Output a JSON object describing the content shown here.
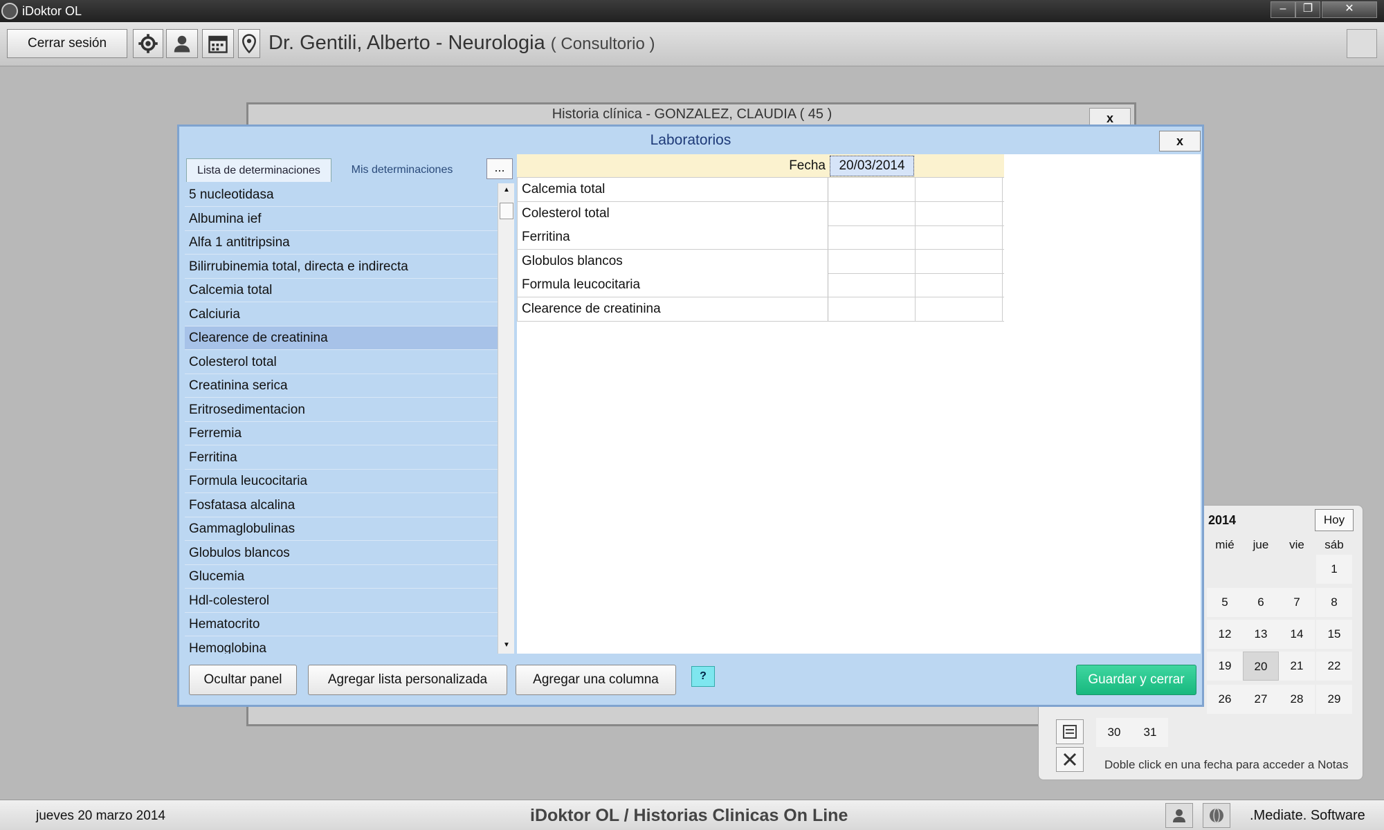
{
  "window": {
    "title": "iDoktor OL",
    "min": "–",
    "max": "❐",
    "close": "✕"
  },
  "toolbar": {
    "logout_label": "Cerrar sesión",
    "doctor": "Dr. Gentili, Alberto - Neurologia",
    "location": "( Consultorio )"
  },
  "history_window": {
    "title": "Historia clínica - GONZALEZ, CLAUDIA ( 45 )",
    "close": "x"
  },
  "dialog": {
    "title": "Laboratorios",
    "close": "x",
    "tabs": [
      "Lista de determinaciones",
      "Mis determinaciones"
    ],
    "more": "...",
    "list": [
      "5 nucleotidasa",
      "Albumina ief",
      "Alfa 1 antitripsina",
      "Bilirrubinemia total, directa e indirecta",
      "Calcemia total",
      "Calciuria",
      "Clearence de creatinina",
      "Colesterol total",
      "Creatinina serica",
      "Eritrosedimentacion",
      "Ferremia",
      "Ferritina",
      "Formula leucocitaria",
      "Fosfatasa alcalina",
      "Gammaglobulinas",
      "Globulos blancos",
      "Glucemia",
      "Hdl-colesterol",
      "Hematocrito",
      "Hemoglobina"
    ],
    "selected_item": "Clearence de creatinina",
    "grid": {
      "date_label": "Fecha",
      "date": "20/03/2014",
      "rows": [
        "Calcemia total",
        "Colesterol total",
        "Ferritina",
        "Globulos blancos",
        "Formula leucocitaria",
        "Clearence de creatinina"
      ]
    },
    "buttons": {
      "hide": "Ocultar panel",
      "add_list": "Agregar lista personalizada",
      "add_column": "Agregar una columna",
      "help": "?",
      "save": "Guardar y cerrar"
    }
  },
  "calendar": {
    "year": "2014",
    "today": "Hoy",
    "day_names": [
      "mié",
      "jue",
      "vie",
      "sáb"
    ],
    "days": [
      "1",
      "5",
      "6",
      "7",
      "8",
      "12",
      "13",
      "14",
      "15",
      "19",
      "20",
      "21",
      "22",
      "26",
      "27",
      "28",
      "29",
      "30",
      "31"
    ],
    "selected_day": "20",
    "note": "Doble click en una fecha para acceder a Notas"
  },
  "status": {
    "date": "jueves 20 marzo 2014",
    "center": "iDoktor OL  /  Historias Clinicas On Line",
    "right": ".Mediate. Software"
  },
  "colors": {
    "dialog_bg": "#bcd7f2",
    "save_button": "#17b87e",
    "help_button": "#7ee6ef",
    "grid_header": "#fbf2cf"
  }
}
